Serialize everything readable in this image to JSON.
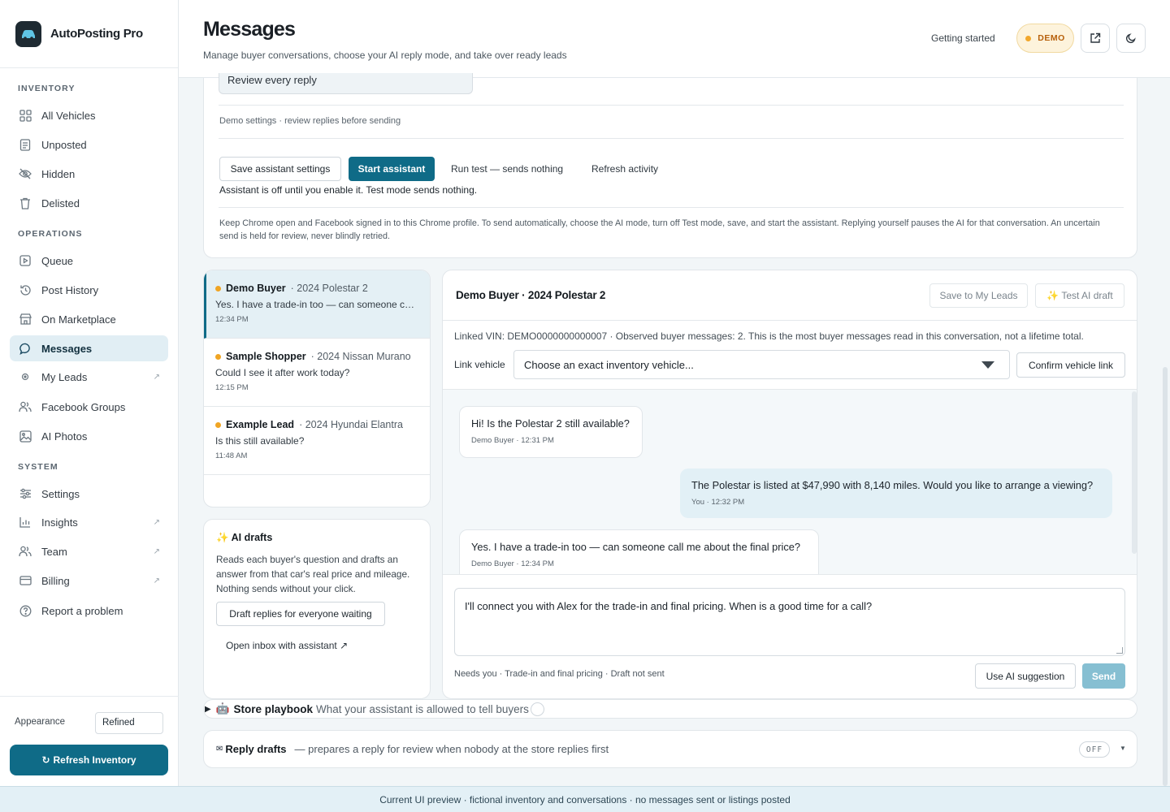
{
  "brand": {
    "name": "AutoPosting Pro"
  },
  "sidebar": {
    "sections": {
      "inventory": "INVENTORY",
      "operations": "OPERATIONS",
      "system": "SYSTEM"
    },
    "items": [
      {
        "label": "All Vehicles",
        "icon": "grid-icon"
      },
      {
        "label": "Unposted",
        "icon": "document-icon"
      },
      {
        "label": "Hidden",
        "icon": "eye-off-icon"
      },
      {
        "label": "Delisted",
        "icon": "trash-icon"
      },
      {
        "label": "Queue",
        "icon": "play-square-icon"
      },
      {
        "label": "Post History",
        "icon": "history-icon"
      },
      {
        "label": "On Marketplace",
        "icon": "store-icon"
      },
      {
        "label": "Messages",
        "icon": "chat-bubble-icon",
        "active": true
      },
      {
        "label": "My Leads",
        "icon": "target-icon",
        "external": true
      },
      {
        "label": "Facebook Groups",
        "icon": "users-icon"
      },
      {
        "label": "AI Photos",
        "icon": "image-icon"
      },
      {
        "label": "Settings",
        "icon": "sliders-icon"
      },
      {
        "label": "Insights",
        "icon": "bar-chart-icon",
        "external": true
      },
      {
        "label": "Team",
        "icon": "team-icon",
        "external": true
      },
      {
        "label": "Billing",
        "icon": "credit-card-icon",
        "external": true
      },
      {
        "label": "Report a problem",
        "icon": "help-circle-icon"
      }
    ],
    "external_glyph": "↗",
    "appearance_label": "Appearance",
    "appearance_value": "Refined",
    "refresh_label": "Refresh Inventory",
    "refresh_glyph": "↻"
  },
  "header": {
    "title": "Messages",
    "subtitle": "Manage buyer conversations, choose your AI reply mode, and take over ready leads",
    "getting_started": "Getting started",
    "demo_badge": "DEMO"
  },
  "settings": {
    "reply_mode_value": "Review every reply",
    "demo_note": "Demo settings · review replies before sending",
    "save_label": "Save assistant settings",
    "start_label": "Start assistant",
    "test_label": "Run test — sends nothing",
    "refresh_activity_label": "Refresh activity",
    "assistant_status": "Assistant is off until you enable it. Test mode sends nothing.",
    "chrome_note": "Keep Chrome open and Facebook signed in to this Chrome profile. To send automatically, choose the AI mode, turn off Test mode, save, and start the assistant. Replying yourself pauses the AI for that conversation. An uncertain send is held for review, never blindly retried."
  },
  "conversations": [
    {
      "name": "Demo Buyer",
      "vehicle": "· 2024 Polestar 2",
      "preview": "Yes. I have a trade-in too — can someone call me about the final price?",
      "time": "12:34 PM",
      "active": true
    },
    {
      "name": "Sample Shopper",
      "vehicle": "· 2024 Nissan Murano",
      "preview": "Could I see it after work today?",
      "time": "12:15 PM"
    },
    {
      "name": "Example Lead",
      "vehicle": "· 2024 Hyundai Elantra",
      "preview": "Is this still available?",
      "time": "11:48 AM"
    }
  ],
  "ai_drafts": {
    "title": "AI drafts",
    "sparkle": "✨",
    "description": "Reads each buyer's question and drafts an answer from that car's real price and mileage. Nothing sends without your click.",
    "draft_all_label": "Draft replies for everyone waiting",
    "open_inbox_label": "Open inbox with assistant ↗"
  },
  "chat": {
    "title": "Demo Buyer · 2024 Polestar 2",
    "save_lead_label": "Save to My Leads",
    "test_draft_label": "✨ Test AI draft",
    "linked_vin": "Linked VIN: DEMO0000000000007 · Observed buyer messages: 2. This is the most buyer messages read in this conversation, not a lifetime total.",
    "link_vehicle_label": "Link vehicle",
    "vehicle_select_value": "Choose an exact inventory vehicle...",
    "confirm_link_label": "Confirm vehicle link",
    "messages": [
      {
        "text": "Hi! Is the Polestar 2 still available?",
        "meta": "Demo Buyer · 12:31 PM",
        "direction": "in"
      },
      {
        "text": "The Polestar is listed at $47,990 with 8,140 miles. Would you like to arrange a viewing?",
        "meta": "You · 12:32 PM",
        "direction": "out"
      },
      {
        "text": "Yes. I have a trade-in too — can someone call me about the final price?",
        "meta": "Demo Buyer · 12:34 PM",
        "direction": "in"
      }
    ],
    "composer_value": "I'll connect you with Alex for the trade-in and final pricing. When is a good time for a call?",
    "composer_status": "Needs you · Trade-in and final pricing · Draft not sent",
    "use_ai_label": "Use AI suggestion",
    "send_label": "Send"
  },
  "playbook": {
    "emoji": "🤖",
    "title": "Store playbook",
    "description": "What your assistant is allowed to tell buyers"
  },
  "reply_drafts": {
    "emoji": "✉",
    "title": "Reply drafts",
    "description": "— prepares a reply for review when nobody at the store replies first",
    "state": "OFF"
  },
  "footer": {
    "text": "Current UI preview · fictional inventory and conversations · no messages sent or listings posted"
  },
  "colors": {
    "accent": "#0f6b87",
    "demo_badge": "#b7600b",
    "unread_dot": "#f0a524"
  }
}
